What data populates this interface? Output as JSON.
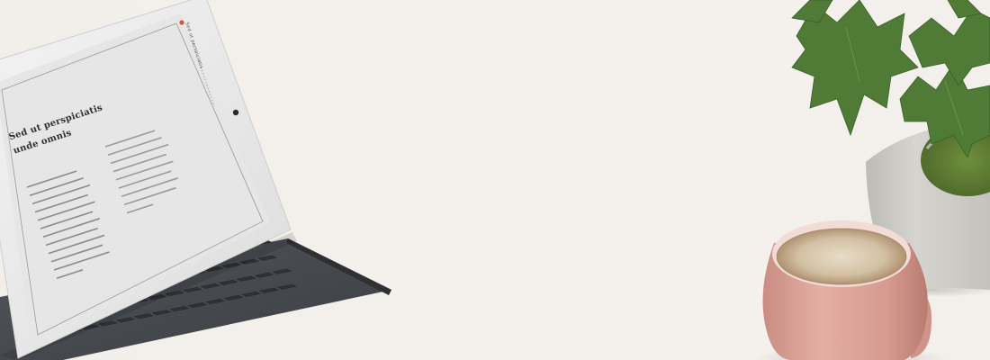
{
  "tablet": {
    "heading_line1": "Sed ut perspiciatis",
    "heading_line2": "unde omnis",
    "brand": "Sed ut perspiciatis",
    "brand_accent_color": "#d5553c"
  },
  "colors": {
    "background": "#f3f0eb",
    "mug": "#d9a198",
    "coffee": "#cbb79c",
    "planter": "#c9c7c1",
    "leaf": "#4e7a37",
    "keyboard": "#45494e",
    "tablet_frame": "#e9e9e9"
  }
}
